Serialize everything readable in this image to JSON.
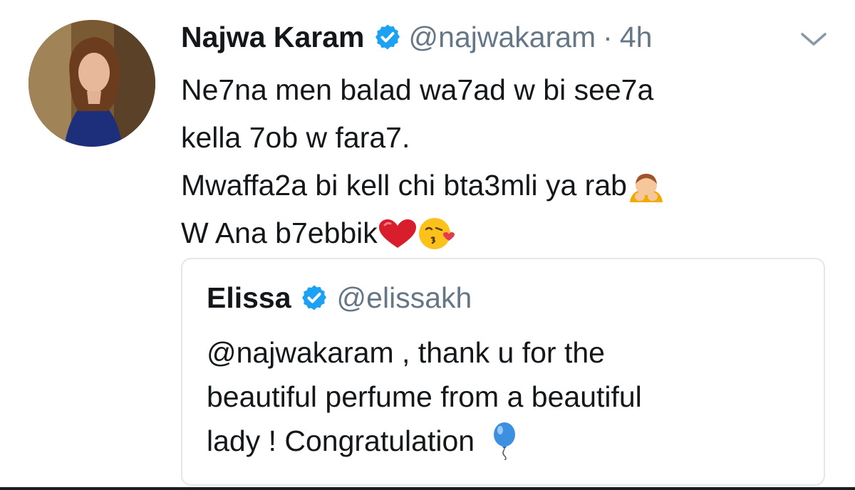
{
  "tweet": {
    "author_name": "Najwa Karam",
    "handle": "@najwakaram",
    "separator": "·",
    "time": "4h",
    "lines": [
      "Ne7na men balad wa7ad w bi see7a",
      "kella 7ob w fara7.",
      "Mwaffa2a bi kell chi bta3mli ya rab",
      "W Ana b7ebbik"
    ]
  },
  "quoted_tweet": {
    "author_name": "Elissa",
    "handle": "@elissakh",
    "lines": [
      "@najwakaram , thank u for the",
      "beautiful perfume from a beautiful",
      "lady ! Congratulation"
    ]
  },
  "icons": {
    "verified": "verified-badge-icon",
    "caret": "chevron-down-icon",
    "emoji_pray": "person-bowing-emoji",
    "emoji_heart": "red-heart-emoji",
    "emoji_kiss": "face-blowing-kiss-emoji",
    "emoji_balloon": "balloon-emoji"
  },
  "colors": {
    "accent": "#1da1f2",
    "text": "#14171a",
    "muted": "#657786",
    "border": "#e1e8ed"
  }
}
